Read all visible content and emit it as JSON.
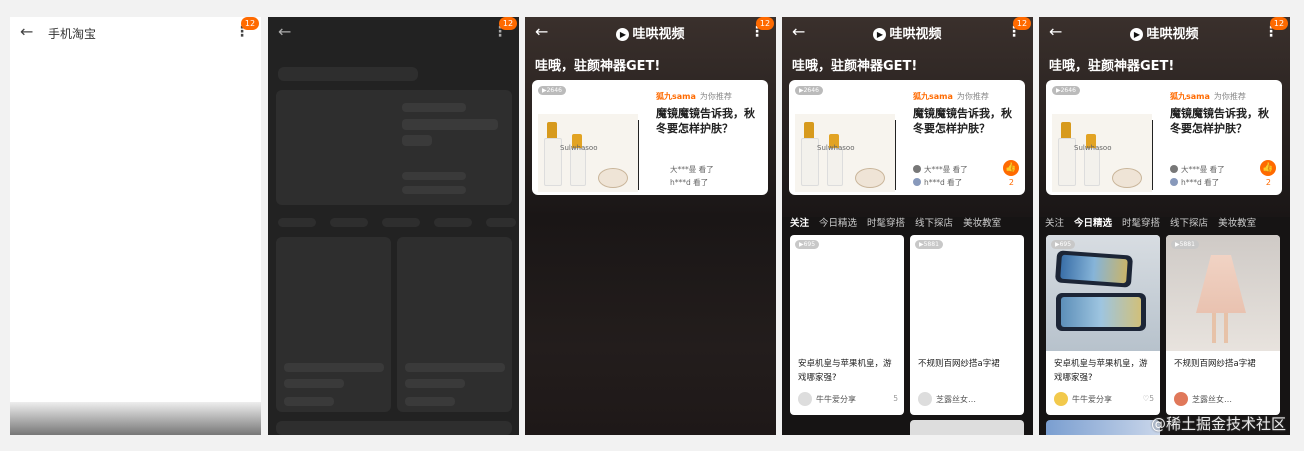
{
  "status_badge": "12",
  "panel1": {
    "app_title": "手机淘宝"
  },
  "brand": {
    "logo_glyph": "▶",
    "name": "哇哄视频"
  },
  "headline": "哇哦，驻颜神器GET!",
  "feature_card": {
    "views": "▶2646",
    "product_text": "Sulwhasoo",
    "author": "狐九sama",
    "recommend": "为你推荐",
    "title": "魔镜魔镜告诉我，秋冬要怎样护肤？",
    "viewers": [
      "大***曼 看了",
      "h***d 看了"
    ],
    "like_icon": "thumbs-up",
    "like_count": "2"
  },
  "tabs": [
    "关注",
    "今日精选",
    "时髦穿搭",
    "线下探店",
    "美妆教室"
  ],
  "grid_cards": [
    {
      "views": "▶695",
      "title": "安卓机皇与苹果机皇，游戏哪家强?",
      "user": "牛牛爱分享",
      "count": "5"
    },
    {
      "views": "▶5881",
      "title": "不规则百网纱搭a字裙",
      "user": "芝露丝女…",
      "count": ""
    }
  ],
  "watermark": "@稀土掘金技术社区",
  "colors": {
    "accent": "#ff6a00",
    "dark_bg": "#161414"
  }
}
